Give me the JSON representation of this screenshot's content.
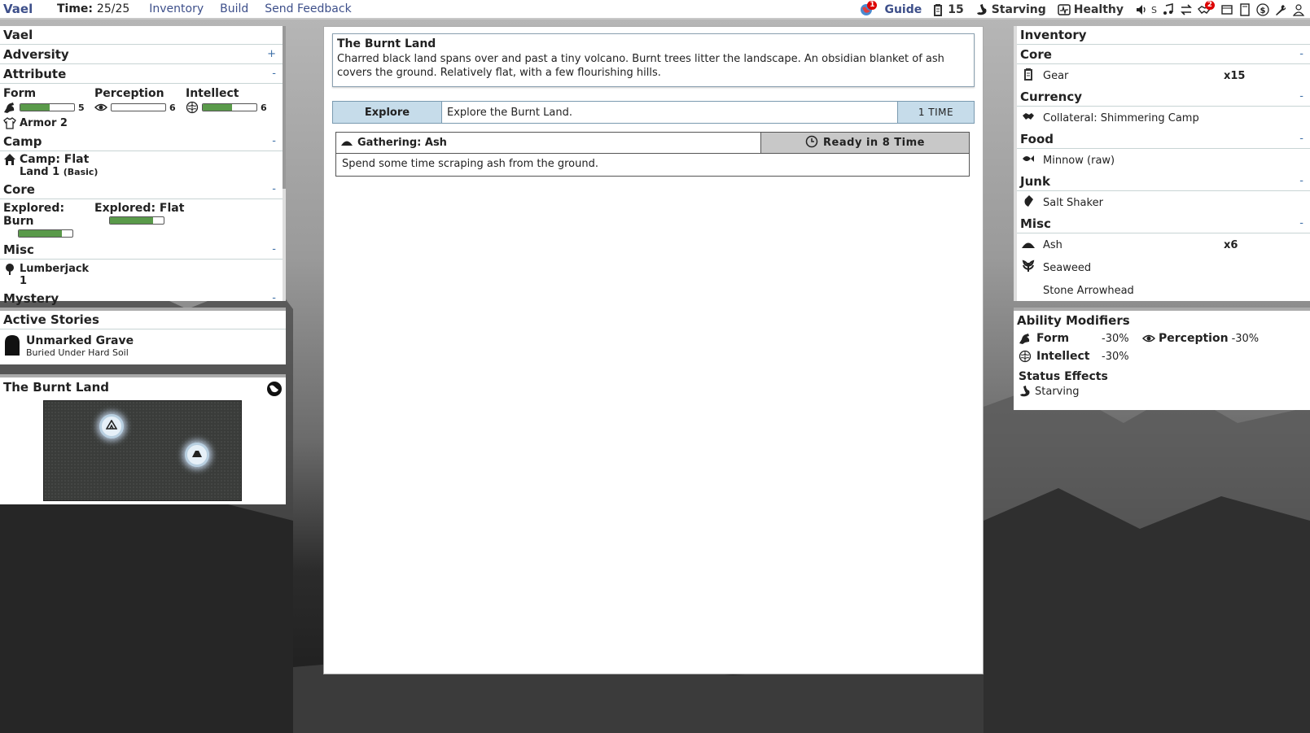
{
  "topbar": {
    "player_name": "Vael",
    "time_label": "Time:",
    "time_value": "25/25",
    "links": [
      "Inventory",
      "Build",
      "Send Feedback"
    ],
    "guide": "Guide",
    "guide_badge": "1",
    "money": "15",
    "hunger_status": "Starving",
    "health_status": "Healthy",
    "sound_label": "S",
    "trade_badge": "2"
  },
  "left": {
    "header": "Vael",
    "adversity": {
      "label": "Adversity",
      "toggle": "+"
    },
    "attribute": {
      "label": "Attribute",
      "toggle": "-"
    },
    "attributes": [
      {
        "label": "Form",
        "value": "5",
        "fill": 0.55
      },
      {
        "label": "Perception",
        "value": "6",
        "fill": 0.0
      },
      {
        "label": "Intellect",
        "value": "6",
        "fill": 0.55
      }
    ],
    "armor": "Armor 2",
    "camp": {
      "label": "Camp",
      "toggle": "-",
      "line1": "Camp: Flat",
      "line2": "Land 1",
      "line2_suffix": "(Basic)"
    },
    "core": {
      "label": "Core",
      "toggle": "-",
      "items": [
        {
          "label": "Explored: Burn",
          "fill": 0.8
        },
        {
          "label": "Explored: Flat",
          "fill": 0.8
        }
      ]
    },
    "misc": {
      "label": "Misc",
      "toggle": "-",
      "item": "Lumberjack",
      "level": "1"
    },
    "mystery": {
      "label": "Mystery",
      "toggle": "-"
    }
  },
  "stories": {
    "header": "Active Stories",
    "title": "Unmarked Grave",
    "subtitle": "Buried Under Hard Soil"
  },
  "map": {
    "header": "The Burnt Land"
  },
  "center": {
    "title": "The Burnt Land",
    "description": "Charred black land spans over and past a tiny volcano. Burnt trees litter the landscape. An obsidian blanket of ash covers the ground. Relatively flat, with a few flourishing hills.",
    "explore_button": "Explore",
    "explore_text": "Explore the Burnt Land.",
    "explore_cost": "1 TIME",
    "gather_title": "Gathering: Ash",
    "gather_ready": "Ready in 8 Time",
    "gather_desc": "Spend some time scraping ash from the ground."
  },
  "inventory": {
    "header": "Inventory",
    "sections": [
      {
        "label": "Core",
        "toggle": "-",
        "items": [
          {
            "icon": "gear-icon",
            "name": "Gear",
            "qty": "x15"
          }
        ]
      },
      {
        "label": "Currency",
        "toggle": "-",
        "items": [
          {
            "icon": "handshake-icon",
            "name": "Collateral: Shimmering Camp",
            "qty": ""
          }
        ]
      },
      {
        "label": "Food",
        "toggle": "-",
        "items": [
          {
            "icon": "fish-icon",
            "name": "Minnow (raw)",
            "qty": ""
          }
        ]
      },
      {
        "label": "Junk",
        "toggle": "-",
        "items": [
          {
            "icon": "salt-shaker-icon",
            "name": "Salt Shaker",
            "qty": ""
          }
        ]
      },
      {
        "label": "Misc",
        "toggle": "-",
        "items": [
          {
            "icon": "ash-pile-icon",
            "name": "Ash",
            "qty": "x6"
          },
          {
            "icon": "seaweed-icon",
            "name": "Seaweed",
            "qty": ""
          },
          {
            "icon": "",
            "name": "Stone Arrowhead",
            "qty": ""
          }
        ]
      }
    ]
  },
  "modifiers": {
    "header": "Ability Modifiers",
    "form_label": "Form",
    "form_value": "-30%",
    "perception_label": "Perception",
    "perception_value": "-30%",
    "intellect_label": "Intellect",
    "intellect_value": "-30%",
    "status_header": "Status Effects",
    "status_item": "Starving"
  }
}
